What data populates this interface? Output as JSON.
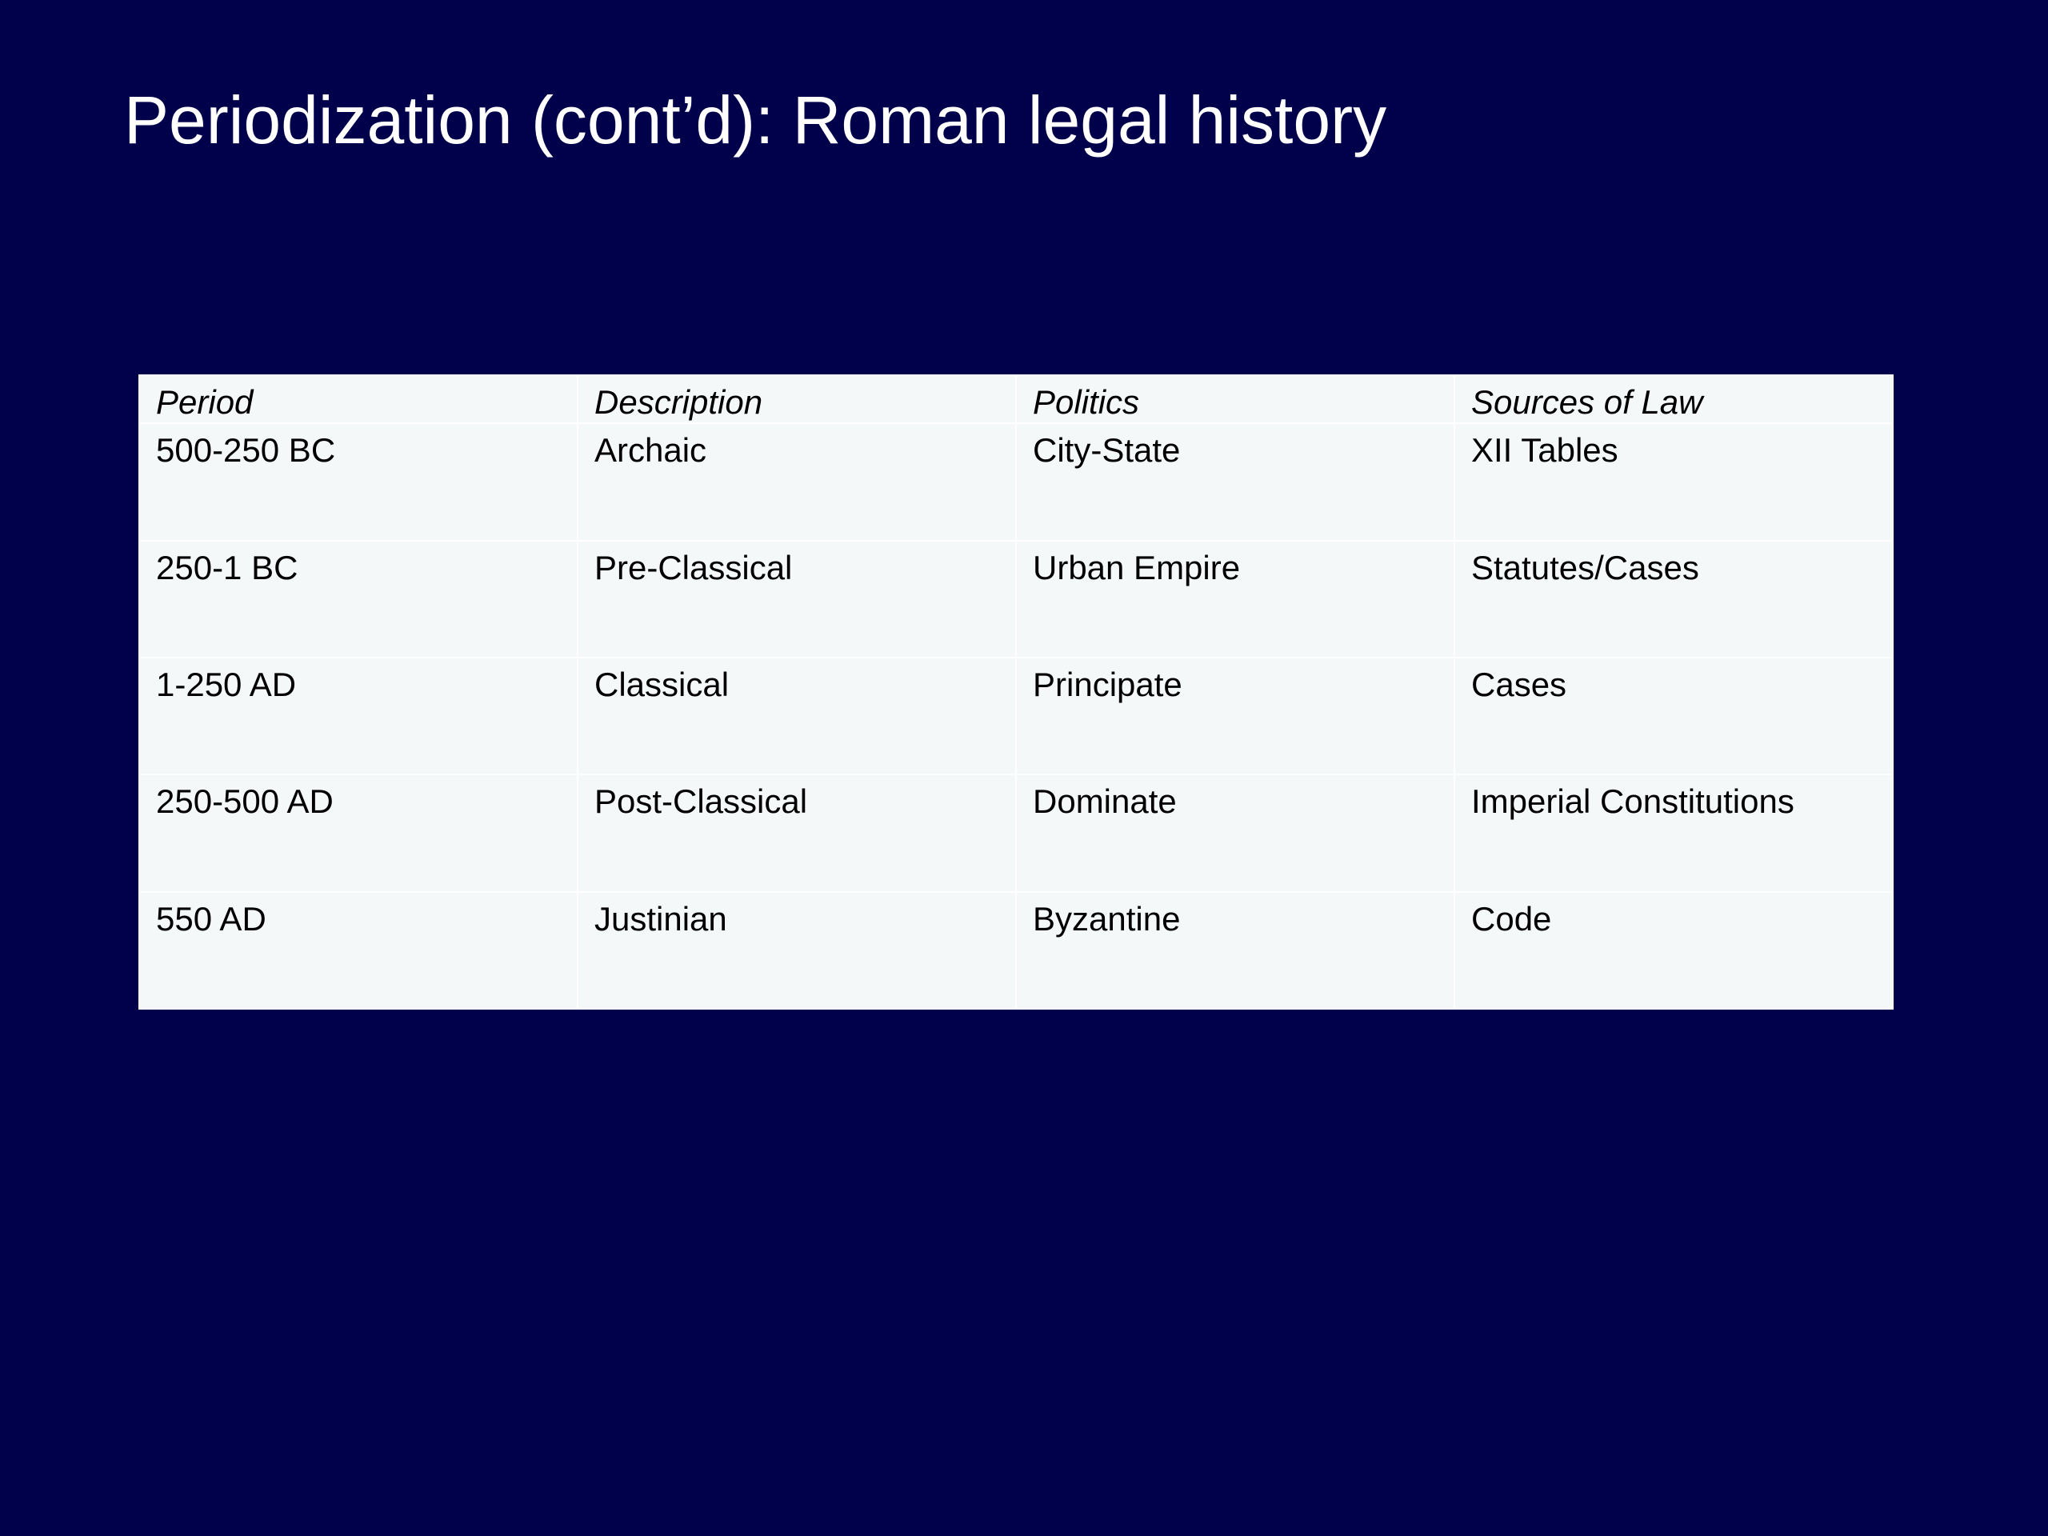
{
  "slide": {
    "title": "Periodization (cont’d): Roman legal history",
    "background_color": "#01014b",
    "table_background_color": "#f4f8f9"
  },
  "table": {
    "headers": [
      "Period",
      "Description",
      "Politics",
      "Sources of Law"
    ],
    "rows": [
      [
        "500-250 BC",
        "Archaic",
        "City-State",
        "XII Tables"
      ],
      [
        "250-1 BC",
        "Pre-Classical",
        "Urban Empire",
        "Statutes/Cases"
      ],
      [
        "1-250 AD",
        "Classical",
        "Principate",
        "Cases"
      ],
      [
        "250-500 AD",
        "Post-Classical",
        "Dominate",
        "Imperial Constitutions"
      ],
      [
        "550 AD",
        "Justinian",
        "Byzantine",
        "Code"
      ]
    ]
  }
}
